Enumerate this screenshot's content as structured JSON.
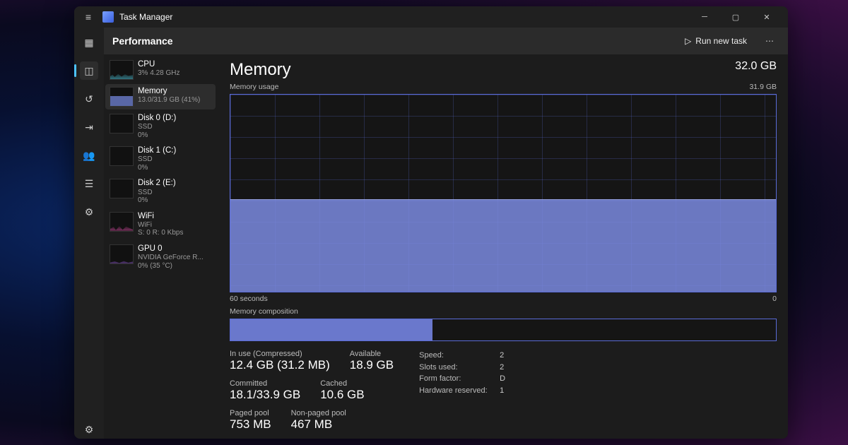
{
  "window": {
    "title": "Task Manager"
  },
  "toolbar": {
    "page": "Performance",
    "run_new_task": "Run new task"
  },
  "sidebar": {
    "items": [
      {
        "name": "CPU",
        "sub1": "3%  4.28 GHz"
      },
      {
        "name": "Memory",
        "sub1": "13.0/31.9 GB (41%)"
      },
      {
        "name": "Disk 0 (D:)",
        "sub1": "SSD",
        "sub2": "0%"
      },
      {
        "name": "Disk 1 (C:)",
        "sub1": "SSD",
        "sub2": "0%"
      },
      {
        "name": "Disk 2 (E:)",
        "sub1": "SSD",
        "sub2": "0%"
      },
      {
        "name": "WiFi",
        "sub1": "WiFi",
        "sub2": "S: 0 R: 0 Kbps"
      },
      {
        "name": "GPU 0",
        "sub1": "NVIDIA GeForce R...",
        "sub2": "0% (35 °C)"
      }
    ]
  },
  "main": {
    "title": "Memory",
    "total": "32.0 GB",
    "usage_label": "Memory usage",
    "usage_max": "31.9 GB",
    "axis_left": "60 seconds",
    "axis_right": "0",
    "comp_label": "Memory composition",
    "stats": {
      "in_use_label": "In use (Compressed)",
      "in_use": "12.4 GB (31.2 MB)",
      "available_label": "Available",
      "available": "18.9 GB",
      "committed_label": "Committed",
      "committed": "18.1/33.9 GB",
      "cached_label": "Cached",
      "cached": "10.6 GB",
      "paged_label": "Paged pool",
      "paged": "753 MB",
      "nonpaged_label": "Non-paged pool",
      "nonpaged": "467 MB",
      "speed_label": "Speed:",
      "speed": "2",
      "slots_label": "Slots used:",
      "slots": "2",
      "form_label": "Form factor:",
      "form": "D",
      "hw_label": "Hardware reserved:",
      "hw": "1"
    }
  },
  "chart_data": {
    "type": "area",
    "title": "Memory usage",
    "ylabel": "GB",
    "ylim": [
      0,
      31.9
    ],
    "xlabel": "seconds",
    "xlim": [
      60,
      0
    ],
    "series": [
      {
        "name": "Memory in use",
        "values": [
          13.0,
          13.0,
          13.1,
          13.0,
          12.9,
          13.0,
          13.0,
          13.1,
          13.0,
          13.0,
          13.0,
          13.0
        ]
      }
    ],
    "composition": {
      "in_use_gb": 12.4,
      "total_gb": 33.9
    }
  }
}
